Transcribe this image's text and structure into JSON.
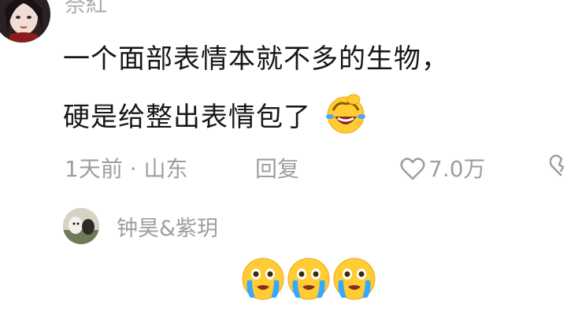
{
  "comment": {
    "username": "奈紅",
    "text_line1": "一个面部表情本就不多的生物，",
    "text_line2": "硬是给整出表情包了",
    "laugh_emoji": "laughing-face-emoji",
    "time_location": "1天前 · 山东",
    "reply_label": "回复",
    "like_count": "7.0万",
    "like_icon": "heart-outline-icon",
    "dislike_icon": "broken-heart-icon"
  },
  "reply": {
    "username": "钟昊&紫玥",
    "emoji": "pleading-tearful-face-emoji",
    "emoji_count": 3
  },
  "colors": {
    "text_primary": "#161616",
    "text_secondary": "#9e9e9e",
    "emoji_yellow": "#ffcc33"
  }
}
